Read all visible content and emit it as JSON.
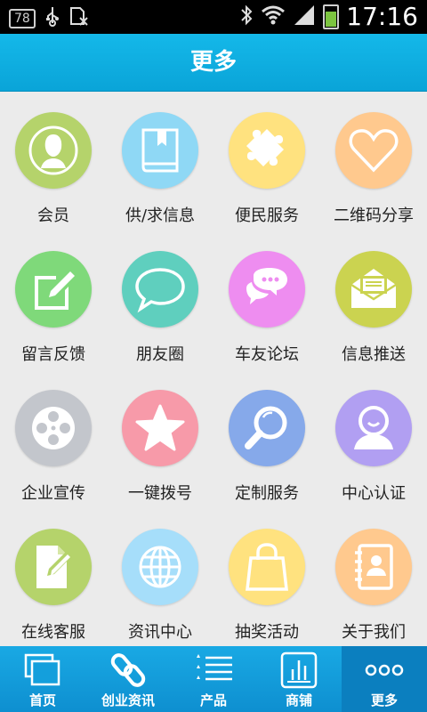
{
  "status_bar": {
    "notification_count": "78",
    "time": "17:16"
  },
  "header": {
    "title": "更多"
  },
  "grid": {
    "items": [
      {
        "label": "会员",
        "icon": "person-icon",
        "color": "#b5d36b"
      },
      {
        "label": "供/求信息",
        "icon": "book-icon",
        "color": "#8fd8f5"
      },
      {
        "label": "便民服务",
        "icon": "puzzle-icon",
        "color": "#ffe27f"
      },
      {
        "label": "二维码分享",
        "icon": "heart-icon",
        "color": "#ffc98e"
      },
      {
        "label": "留言反馈",
        "icon": "edit-icon",
        "color": "#7fd97a"
      },
      {
        "label": "朋友圈",
        "icon": "chat-bubble-icon",
        "color": "#5fcfbe"
      },
      {
        "label": "车友论坛",
        "icon": "chat-dots-icon",
        "color": "#ee8df0"
      },
      {
        "label": "信息推送",
        "icon": "envelope-icon",
        "color": "#cbd350"
      },
      {
        "label": "企业宣传",
        "icon": "film-reel-icon",
        "color": "#c3c6cc"
      },
      {
        "label": "一键拨号",
        "icon": "star-icon",
        "color": "#f79aa9"
      },
      {
        "label": "定制服务",
        "icon": "magnifier-icon",
        "color": "#86a9ea"
      },
      {
        "label": "中心认证",
        "icon": "user-smile-icon",
        "color": "#b19ff2"
      },
      {
        "label": "在线客服",
        "icon": "document-pen-icon",
        "color": "#b5d36b"
      },
      {
        "label": "资讯中心",
        "icon": "globe-icon",
        "color": "#a6defa"
      },
      {
        "label": "抽奖活动",
        "icon": "shopping-bag-icon",
        "color": "#ffe27f"
      },
      {
        "label": "关于我们",
        "icon": "contact-book-icon",
        "color": "#ffc98e"
      }
    ]
  },
  "tabbar": {
    "tabs": [
      {
        "label": "首页",
        "icon": "windows-icon"
      },
      {
        "label": "创业资讯",
        "icon": "link-icon"
      },
      {
        "label": "产品",
        "icon": "list-icon"
      },
      {
        "label": "商铺",
        "icon": "chart-icon"
      },
      {
        "label": "更多",
        "icon": "more-dots-icon",
        "active": true
      }
    ]
  }
}
